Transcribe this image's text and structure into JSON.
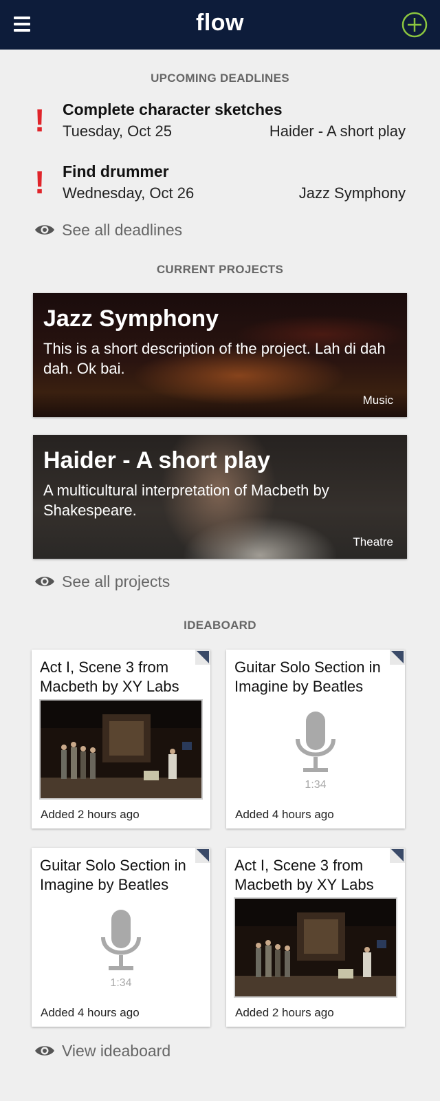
{
  "header": {
    "title": "flow",
    "menu_icon": "hamburger-menu-icon",
    "add_icon": "plus-circle-icon",
    "bg_color": "#0d1c3a",
    "accent_color": "#8cc63f"
  },
  "deadlines": {
    "heading": "UPCOMING DEADLINES",
    "items": [
      {
        "title": "Complete character sketches",
        "date": "Tuesday, Oct 25",
        "project": "Haider - A short play",
        "urgent_icon": "!"
      },
      {
        "title": "Find drummer",
        "date": "Wednesday, Oct 26",
        "project": "Jazz Symphony",
        "urgent_icon": "!"
      }
    ],
    "see_all": "See all deadlines"
  },
  "projects": {
    "heading": "CURRENT PROJECTS",
    "items": [
      {
        "title": "Jazz Symphony",
        "description": "This is a short description of the project. Lah di dah dah. Ok bai.",
        "category": "Music"
      },
      {
        "title": "Haider - A short play",
        "description": "A multicultural interpretation of Macbeth by Shakespeare.",
        "category": "Theatre"
      }
    ],
    "see_all": "See all projects"
  },
  "ideaboard": {
    "heading": "IDEABOARD",
    "items": [
      {
        "title": "Act I, Scene 3 from Macbeth by XY Labs",
        "type": "photo",
        "added": "Added 2 hours ago"
      },
      {
        "title": "Guitar Solo Section in Imagine by Beatles",
        "type": "audio",
        "duration": "1:34",
        "added": "Added 4 hours ago"
      },
      {
        "title": "Guitar Solo Section in Imagine by Beatles",
        "type": "audio",
        "duration": "1:34",
        "added": "Added 4 hours ago"
      },
      {
        "title": "Act I, Scene 3 from Macbeth by XY Labs",
        "type": "photo",
        "added": "Added 2 hours ago"
      }
    ],
    "view_all": "View ideaboard"
  }
}
